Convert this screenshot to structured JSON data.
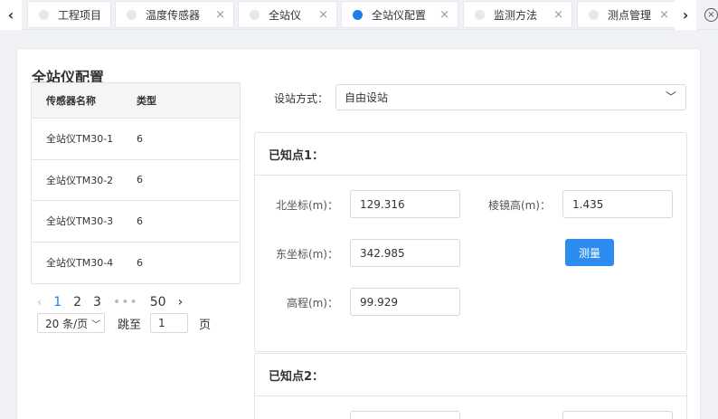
{
  "tabs": [
    {
      "label": "工程项目",
      "active": false,
      "closable": false
    },
    {
      "label": "温度传感器",
      "active": false,
      "closable": true
    },
    {
      "label": "全站仪",
      "active": false,
      "closable": true
    },
    {
      "label": "全站仪配置",
      "active": true,
      "closable": true
    },
    {
      "label": "监测方法",
      "active": false,
      "closable": true
    },
    {
      "label": "测点管理",
      "active": false,
      "closable": true
    }
  ],
  "nav": {
    "prev": "‹",
    "next": "›",
    "close_all": "×",
    "tab_close": "×"
  },
  "page_title": "全站仪配置",
  "table": {
    "headers": {
      "name": "传感器名称",
      "type": "类型"
    },
    "rows": [
      {
        "name": "全站仪TM30-1",
        "type": "6"
      },
      {
        "name": "全站仪TM30-2",
        "type": "6"
      },
      {
        "name": "全站仪TM30-3",
        "type": "6"
      },
      {
        "name": "全站仪TM30-4",
        "type": "6"
      }
    ]
  },
  "pagination": {
    "prev": "‹",
    "pages": [
      "1",
      "2",
      "3"
    ],
    "ellipsis": "•••",
    "last": "50",
    "next": "›",
    "page_size": "20 条/页",
    "jump_label": "跳至",
    "jump_value": "1",
    "jump_suffix": "页"
  },
  "station_mode": {
    "label": "设站方式：",
    "value": "自由设站"
  },
  "known_points": [
    {
      "title": "已知点1：",
      "north_label": "北坐标(m)：",
      "north_value": "129.316",
      "prism_label": "棱镜高(m)：",
      "prism_value": "1.435",
      "east_label": "东坐标(m)：",
      "east_value": "342.985",
      "measure_button": "测量",
      "elev_label": "高程(m)：",
      "elev_value": "99.929"
    },
    {
      "title": "已知点2："
    }
  ],
  "colors": {
    "accent": "#2d8cf0",
    "active_dot": "#1e7ee8"
  }
}
